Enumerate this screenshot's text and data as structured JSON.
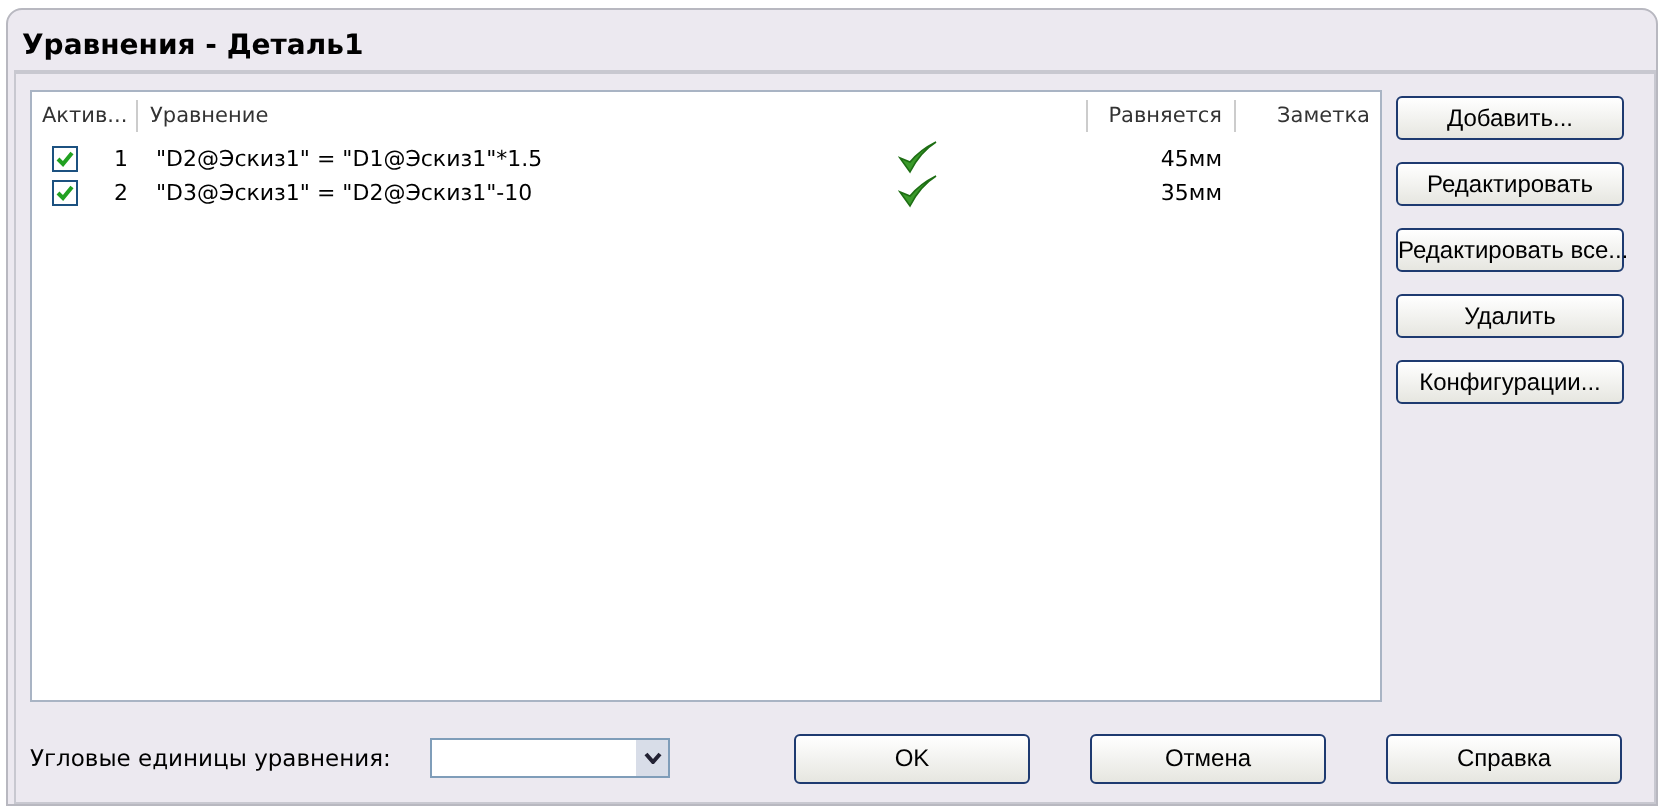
{
  "window": {
    "title": "Уравнения - Деталь1"
  },
  "table": {
    "columns": [
      "Актив...",
      "Уравнение",
      "Равняется",
      "Заметка"
    ],
    "rows": [
      {
        "active": true,
        "number": "1",
        "equation": "\"D2@Эскиз1\" = \"D1@Эскиз1\"*1.5",
        "valid": true,
        "value": "45мм"
      },
      {
        "active": true,
        "number": "2",
        "equation": "\"D3@Эскиз1\" = \"D2@Эскиз1\"-10",
        "valid": true,
        "value": "35мм"
      }
    ]
  },
  "side_buttons": [
    "Добавить...",
    "Редактировать",
    "Редактировать все...",
    "Удалить",
    "Конфигурации..."
  ],
  "angle_units": {
    "label": "Угловые единицы уравнения:"
  },
  "buttons": [
    "OK",
    "Отмена",
    "Справка"
  ]
}
